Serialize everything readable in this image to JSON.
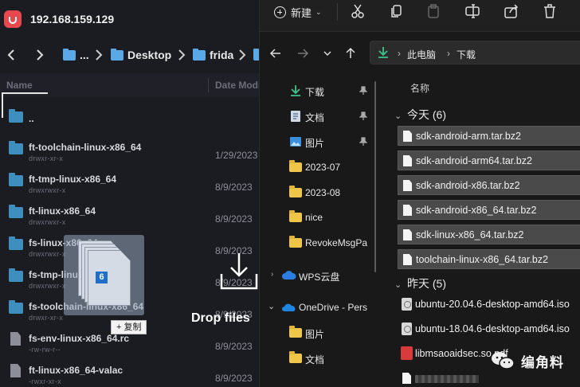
{
  "sftp": {
    "host": "192.168.159.129",
    "breadcrumb": [
      "...",
      "Desktop",
      "frida"
    ],
    "columns": {
      "name": "Name",
      "date": "Date Modi"
    },
    "rows": [
      {
        "name": "..",
        "perm": "",
        "date": "",
        "type": "folder"
      },
      {
        "name": "ft-toolchain-linux-x86_64",
        "perm": "drwxr-xr-x",
        "date": "1/29/2023",
        "type": "folder"
      },
      {
        "name": "ft-tmp-linux-x86_64",
        "perm": "drwxrwxr-x",
        "date": "8/9/2023",
        "type": "folder"
      },
      {
        "name": "ft-linux-x86_64",
        "perm": "drwxrwxr-x",
        "date": "8/9/2023",
        "type": "folder"
      },
      {
        "name": "fs-linux-x86_64",
        "perm": "drwxrwxr-x",
        "date": "8/9/2023",
        "type": "folder"
      },
      {
        "name": "fs-tmp-linux-x86_64",
        "perm": "drwxrwxr-x",
        "date": "8/9/2023",
        "type": "folder"
      },
      {
        "name": "fs-toolchain-linux-x86_64",
        "perm": "drwxr-xr-x",
        "date": "8/9/2023",
        "type": "folder"
      },
      {
        "name": "fs-env-linux-x86_64.rc",
        "perm": "-rw-rw-r--",
        "date": "8/9/2023",
        "type": "file"
      },
      {
        "name": "ft-linux-x86_64-valac",
        "perm": "-rwxr-xr-x",
        "date": "8/9/2023",
        "type": "file"
      }
    ],
    "drag": {
      "count": "6",
      "copy_label": "+ 复制"
    },
    "drop_text": "Drop files"
  },
  "explorer": {
    "new_label": "新建",
    "address": {
      "root": "此电脑",
      "folder": "下载"
    },
    "nav": [
      {
        "label": "下载",
        "icon": "download-icon",
        "pinned": true
      },
      {
        "label": "文档",
        "icon": "document-icon",
        "pinned": true
      },
      {
        "label": "图片",
        "icon": "picture-icon",
        "pinned": true
      },
      {
        "label": "2023-07",
        "icon": "folder-icon",
        "pinned": false
      },
      {
        "label": "2023-08",
        "icon": "folder-icon",
        "pinned": false
      },
      {
        "label": "nice",
        "icon": "folder-icon",
        "pinned": false
      },
      {
        "label": "RevokeMsgPa",
        "icon": "folder-icon",
        "pinned": false
      },
      {
        "label": "WPS云盘",
        "icon": "cloud-icon",
        "pinned": false
      },
      {
        "label": "OneDrive - Pers",
        "icon": "onedrive-icon",
        "pinned": false
      },
      {
        "label": "图片",
        "icon": "folder-icon",
        "pinned": false
      },
      {
        "label": "文档",
        "icon": "folder-icon",
        "pinned": false
      }
    ],
    "column_name": "名称",
    "groups": [
      {
        "label": "今天 (6)",
        "files": [
          "sdk-android-arm.tar.bz2",
          "sdk-android-arm64.tar.bz2",
          "sdk-android-x86.tar.bz2",
          "sdk-android-x86_64.tar.bz2",
          "sdk-linux-x86_64.tar.bz2",
          "toolchain-linux-x86_64.tar.bz2"
        ]
      },
      {
        "label": "昨天 (5)",
        "files": [
          "ubuntu-20.04.6-desktop-amd64.iso",
          "ubuntu-18.04.6-desktop-amd64.iso",
          "libmsaoaidsec.so.pdf"
        ]
      }
    ]
  },
  "watermark": "编角料",
  "colors": {
    "accent_blue": "#5aa9e6",
    "folder_yellow": "#f0c648",
    "selection": "#4a4a4a"
  }
}
